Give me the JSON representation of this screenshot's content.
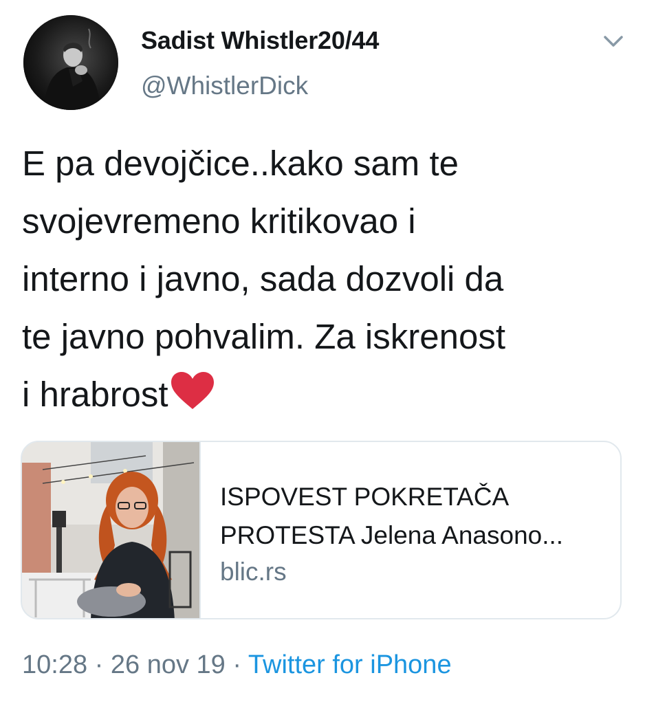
{
  "user": {
    "display_name": "Sadist Whistler20/44",
    "handle": "@WhistlerDick"
  },
  "tweet": {
    "lines": [
      "E pa devojčice..kako sam te",
      "svojevremeno kritikovao i",
      "interno i javno, sada dozvoli da",
      "te javno pohvalim. Za iskrenost",
      "i hrabrost"
    ],
    "emoji": "heart-icon",
    "emoji_color": "#dd2e44"
  },
  "card": {
    "title_line1": "ISPOVEST POKRETAČA",
    "title_line2": "PROTESTA Jelena Anasono...",
    "domain": "blic.rs"
  },
  "meta": {
    "time": "10:28",
    "separator": "·",
    "date": "26 nov 19",
    "source": "Twitter for iPhone"
  },
  "colors": {
    "text": "#14171a",
    "secondary": "#657786",
    "link": "#1b95e0",
    "border": "#e1e8ed"
  }
}
